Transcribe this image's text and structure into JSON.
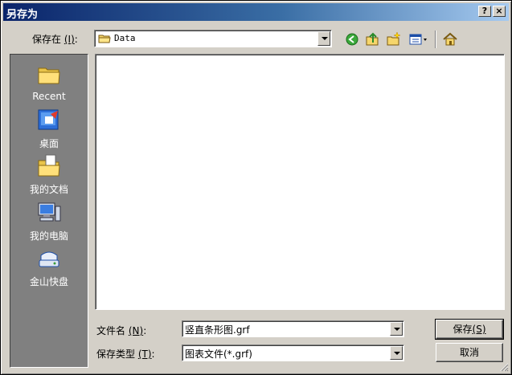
{
  "window": {
    "title": "另存为"
  },
  "titlebar_buttons": {
    "help": "?",
    "close": "×"
  },
  "save_in": {
    "label": "保存在",
    "hotkey": "(I)",
    "colon": ":",
    "current_folder": "Data"
  },
  "toolbar": {
    "icons": [
      "back-icon",
      "up-folder-icon",
      "new-folder-icon",
      "view-menu-icon",
      "home-icon"
    ]
  },
  "places": [
    {
      "name": "recent",
      "label": "Recent",
      "icon": "recent-folder-icon"
    },
    {
      "name": "desktop",
      "label": "桌面",
      "icon": "desktop-icon"
    },
    {
      "name": "documents",
      "label": "我的文档",
      "icon": "my-documents-icon"
    },
    {
      "name": "computer",
      "label": "我的电脑",
      "icon": "my-computer-icon"
    },
    {
      "name": "kuaipan",
      "label": "金山快盘",
      "icon": "drive-icon"
    }
  ],
  "filename": {
    "label": "文件名",
    "hotkey": "(N)",
    "colon": ":",
    "value": "竖直条形图.grf"
  },
  "filetype": {
    "label": "保存类型",
    "hotkey": "(T)",
    "colon": ":",
    "value": "图表文件(*.grf)"
  },
  "buttons": {
    "save": "保存",
    "save_hotkey": "(S)",
    "cancel": "取消"
  },
  "colors": {
    "title_gradient_start": "#0a246a",
    "title_gradient_end": "#a6caf0",
    "face": "#d4d0c8",
    "places_bg": "#808080"
  }
}
